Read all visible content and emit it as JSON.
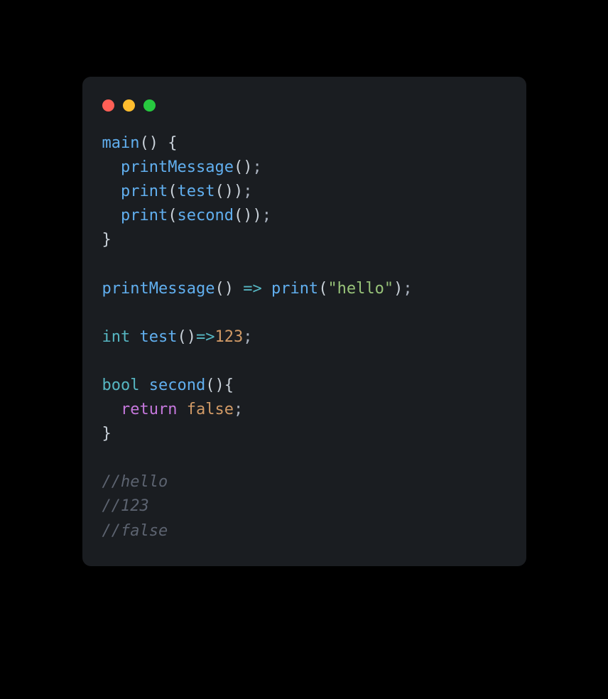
{
  "titlebar": {
    "red": "close",
    "yellow": "minimize",
    "green": "maximize"
  },
  "code": {
    "l1_fn": "main",
    "l1_open": "(",
    "l1_close": ")",
    "l1_sp": " ",
    "l1_brace": "{",
    "l2_indent": "  ",
    "l2_fn": "printMessage",
    "l2_open": "(",
    "l2_close": ")",
    "l2_semi": ";",
    "l3_indent": "  ",
    "l3_fn": "print",
    "l3_open": "(",
    "l3_fn2": "test",
    "l3_open2": "(",
    "l3_close2": ")",
    "l3_close": ")",
    "l3_semi": ";",
    "l4_indent": "  ",
    "l4_fn": "print",
    "l4_open": "(",
    "l4_fn2": "second",
    "l4_open2": "(",
    "l4_close2": ")",
    "l4_close": ")",
    "l4_semi": ";",
    "l5_brace": "}",
    "l7_fn": "printMessage",
    "l7_open": "(",
    "l7_close": ")",
    "l7_sp1": " ",
    "l7_arrow": "=>",
    "l7_sp2": " ",
    "l7_fn2": "print",
    "l7_open2": "(",
    "l7_str": "\"hello\"",
    "l7_close2": ")",
    "l7_semi": ";",
    "l9_type": "int",
    "l9_sp": " ",
    "l9_fn": "test",
    "l9_open": "(",
    "l9_close": ")",
    "l9_arrow": "=>",
    "l9_num": "123",
    "l9_semi": ";",
    "l11_type": "bool",
    "l11_sp": " ",
    "l11_fn": "second",
    "l11_open": "(",
    "l11_close": ")",
    "l11_brace": "{",
    "l12_indent": "  ",
    "l12_kw": "return",
    "l12_sp": " ",
    "l12_lit": "false",
    "l12_semi": ";",
    "l13_brace": "}",
    "l15_comment": "//hello",
    "l16_comment": "//123",
    "l17_comment": "//false"
  }
}
